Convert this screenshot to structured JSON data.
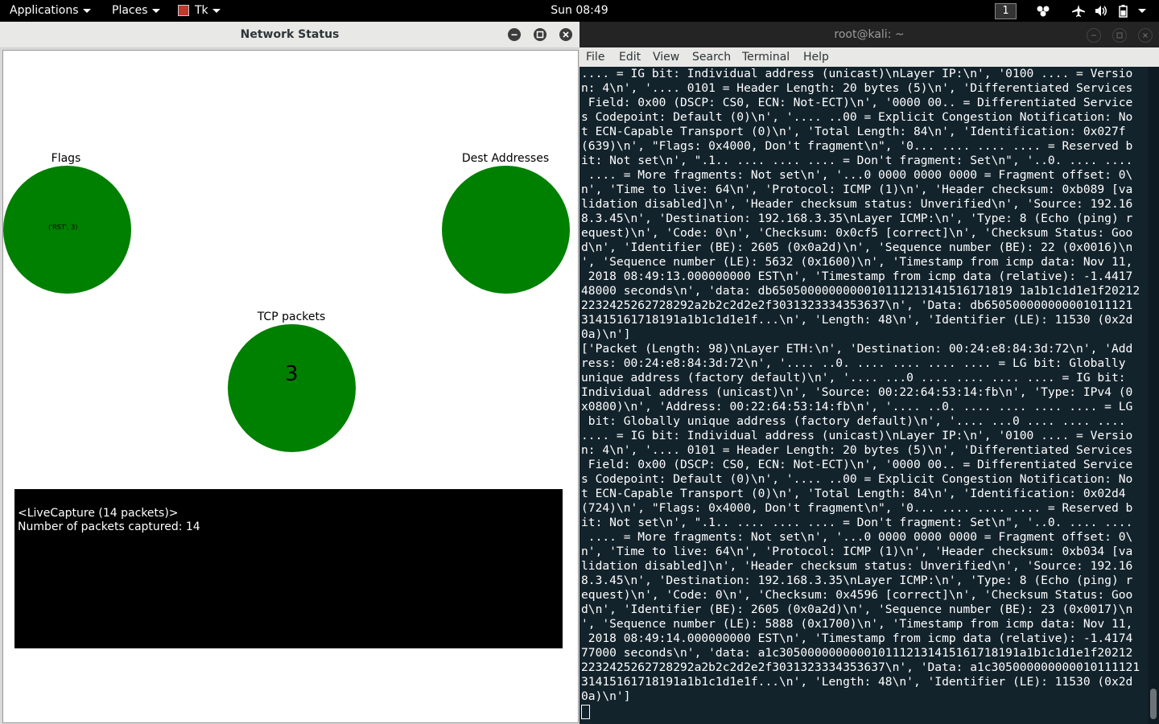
{
  "topbar": {
    "applications": "Applications",
    "places": "Places",
    "tk": "Tk",
    "clock": "Sun 08:49",
    "workspace": "1",
    "icons": [
      "workspace-switcher-icon",
      "airplane-mode-icon",
      "volume-icon",
      "battery-icon",
      "system-menu-caret-icon"
    ]
  },
  "tk_window": {
    "title": "Network Status",
    "nodes": {
      "flags": {
        "label": "Flags",
        "value": "('RST', 3)"
      },
      "dest": {
        "label": "Dest Addresses",
        "value": ""
      },
      "tcp": {
        "label": "TCP packets",
        "value": "3"
      }
    },
    "node_color": "#008000",
    "capture": {
      "line1": "<LiveCapture (14 packets)>",
      "line2": "Number of packets captured: 14"
    }
  },
  "terminal": {
    "title": "root@kali: ~",
    "menu": [
      "File",
      "Edit",
      "View",
      "Search",
      "Terminal",
      "Help"
    ],
    "lines": [
      ".... = IG bit: Individual address (unicast)\\nLayer IP:\\n', '0100 .... = Versio",
      "n: 4\\n', '.... 0101 = Header Length: 20 bytes (5)\\n', 'Differentiated Services",
      " Field: 0x00 (DSCP: CS0, ECN: Not-ECT)\\n', '0000 00.. = Differentiated Service",
      "s Codepoint: Default (0)\\n', '.... ..00 = Explicit Congestion Notification: No",
      "t ECN-Capable Transport (0)\\n', 'Total Length: 84\\n', 'Identification: 0x027f",
      "(639)\\n', \"Flags: 0x4000, Don't fragment\\n\", '0... .... .... .... = Reserved b",
      "it: Not set\\n', \".1.. .... .... .... = Don't fragment: Set\\n\", '..0. .... ....",
      " .... = More fragments: Not set\\n', '...0 0000 0000 0000 = Fragment offset: 0\\",
      "n', 'Time to live: 64\\n', 'Protocol: ICMP (1)\\n', 'Header checksum: 0xb089 [va",
      "lidation disabled]\\n', 'Header checksum status: Unverified\\n', 'Source: 192.16",
      "8.3.45\\n', 'Destination: 192.168.3.35\\nLayer ICMP:\\n', 'Type: 8 (Echo (ping) r",
      "equest)\\n', 'Code: 0\\n', 'Checksum: 0x0cf5 [correct]\\n', 'Checksum Status: Goo",
      "d\\n', 'Identifier (BE): 2605 (0x0a2d)\\n', 'Sequence number (BE): 22 (0x0016)\\n",
      "', 'Sequence number (LE): 5632 (0x1600)\\n', 'Timestamp from icmp data: Nov 11,",
      " 2018 08:49:13.000000000 EST\\n', 'Timestamp from icmp data (relative): -1.4417",
      "48000 seconds\\n', 'data: db6505000000000010111213141516171819 1a1b1c1d1e1f20212",
      "2232425262728292a2b2c2d2e2f3031323334353637\\n', 'Data: db650500000000001011121",
      "31415161718191a1b1c1d1e1f...\\n', 'Length: 48\\n', 'Identifier (LE): 11530 (0x2d",
      "0a)\\n']",
      "['Packet (Length: 98)\\nLayer ETH:\\n', 'Destination: 00:24:e8:84:3d:72\\n', 'Add",
      "ress: 00:24:e8:84:3d:72\\n', '.... ..0. .... .... .... .... = LG bit: Globally",
      "unique address (factory default)\\n', '.... ...0 .... .... .... .... = IG bit:",
      "Individual address (unicast)\\n', 'Source: 00:22:64:53:14:fb\\n', 'Type: IPv4 (0",
      "x0800)\\n', 'Address: 00:22:64:53:14:fb\\n', '.... ..0. .... .... .... .... = LG",
      " bit: Globally unique address (factory default)\\n', '.... ...0 .... .... ....",
      ".... = IG bit: Individual address (unicast)\\nLayer IP:\\n', '0100 .... = Versio",
      "n: 4\\n', '.... 0101 = Header Length: 20 bytes (5)\\n', 'Differentiated Services",
      " Field: 0x00 (DSCP: CS0, ECN: Not-ECT)\\n', '0000 00.. = Differentiated Service",
      "s Codepoint: Default (0)\\n', '.... ..00 = Explicit Congestion Notification: No",
      "t ECN-Capable Transport (0)\\n', 'Total Length: 84\\n', 'Identification: 0x02d4",
      "(724)\\n', \"Flags: 0x4000, Don't fragment\\n\", '0... .... .... .... = Reserved b",
      "it: Not set\\n', \".1.. .... .... .... = Don't fragment: Set\\n\", '..0. .... ....",
      " .... = More fragments: Not set\\n', '...0 0000 0000 0000 = Fragment offset: 0\\",
      "n', 'Time to live: 64\\n', 'Protocol: ICMP (1)\\n', 'Header checksum: 0xb034 [va",
      "lidation disabled]\\n', 'Header checksum status: Unverified\\n', 'Source: 192.16",
      "8.3.45\\n', 'Destination: 192.168.3.35\\nLayer ICMP:\\n', 'Type: 8 (Echo (ping) r",
      "equest)\\n', 'Code: 0\\n', 'Checksum: 0x4596 [correct]\\n', 'Checksum Status: Goo",
      "d\\n', 'Identifier (BE): 2605 (0x0a2d)\\n', 'Sequence number (BE): 23 (0x0017)\\n",
      "', 'Sequence number (LE): 5888 (0x1700)\\n', 'Timestamp from icmp data: Nov 11,",
      " 2018 08:49:14.000000000 EST\\n', 'Timestamp from icmp data (relative): -1.4174",
      "77000 seconds\\n', 'data: a1c3050000000000101112131415161718191a1b1c1d1e1f20212",
      "2232425262728292a2b2c2d2e2f3031323334353637\\n', 'Data: a1c305000000000010111121",
      "31415161718191a1b1c1d1e1f...\\n', 'Length: 48\\n', 'Identifier (LE): 11530 (0x2d",
      "0a)\\n']"
    ]
  }
}
